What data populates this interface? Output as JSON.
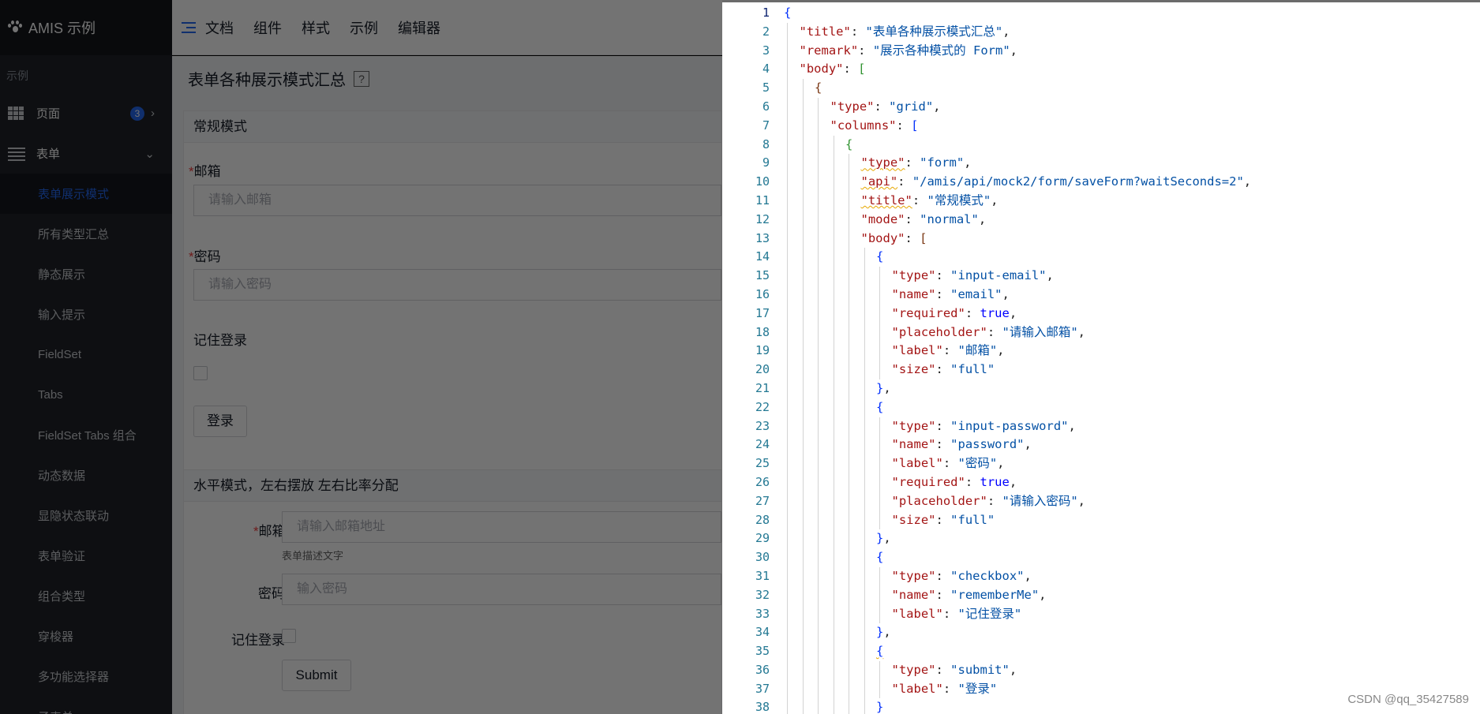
{
  "app": {
    "brand": "AMIS 示例",
    "section_label": "示例",
    "nav": {
      "page": {
        "label": "页面",
        "badge": "3"
      },
      "form": {
        "label": "表单"
      }
    },
    "sub_items": [
      {
        "label": "表单展示模式",
        "active": true
      },
      {
        "label": "所有类型汇总"
      },
      {
        "label": "静态展示"
      },
      {
        "label": "输入提示"
      },
      {
        "label": "FieldSet"
      },
      {
        "label": "Tabs"
      },
      {
        "label": "FieldSet Tabs 组合"
      },
      {
        "label": "动态数据"
      },
      {
        "label": "显隐状态联动"
      },
      {
        "label": "表单验证"
      },
      {
        "label": "组合类型"
      },
      {
        "label": "穿梭器"
      },
      {
        "label": "多功能选择器"
      },
      {
        "label": "子表单"
      }
    ],
    "topbar": [
      "文档",
      "组件",
      "样式",
      "示例",
      "编辑器"
    ],
    "page_title": "表单各种展示模式汇总",
    "help": "?",
    "panel1": {
      "title": "常规模式",
      "email_label": "邮箱",
      "email_placeholder": "请输入邮箱",
      "password_label": "密码",
      "password_placeholder": "请输入密码",
      "remember_label": "记住登录",
      "login_button": "登录"
    },
    "panel2": {
      "title": "水平模式，左右摆放 左右比率分配",
      "email_label": "邮箱",
      "email_placeholder": "请输入邮箱地址",
      "email_desc": "表单描述文字",
      "password_label": "密码",
      "password_placeholder": "输入密码",
      "remember_label": "记住登录",
      "submit_button": "Submit"
    }
  },
  "editor": {
    "line_numbers": [
      "1",
      "2",
      "3",
      "4",
      "5",
      "6",
      "7",
      "8",
      "9",
      "10",
      "11",
      "12",
      "13",
      "14",
      "15",
      "16",
      "17",
      "18",
      "19",
      "20",
      "21",
      "22",
      "23",
      "24",
      "25",
      "26",
      "27",
      "28",
      "29",
      "30",
      "31",
      "32",
      "33",
      "34",
      "35",
      "36",
      "37",
      "38"
    ],
    "lines": [
      {
        "indent": 0,
        "tokens": [
          {
            "t": "{",
            "c": "br1"
          }
        ]
      },
      {
        "indent": 1,
        "tokens": [
          {
            "t": "\"title\"",
            "c": "k"
          },
          {
            "t": ": ",
            "c": "p"
          },
          {
            "t": "\"表单各种展示模式汇总\"",
            "c": "s"
          },
          {
            "t": ",",
            "c": "p"
          }
        ]
      },
      {
        "indent": 1,
        "tokens": [
          {
            "t": "\"remark\"",
            "c": "k"
          },
          {
            "t": ": ",
            "c": "p"
          },
          {
            "t": "\"展示各种模式的 Form\"",
            "c": "s"
          },
          {
            "t": ",",
            "c": "p"
          }
        ]
      },
      {
        "indent": 1,
        "tokens": [
          {
            "t": "\"body\"",
            "c": "k"
          },
          {
            "t": ": ",
            "c": "p"
          },
          {
            "t": "[",
            "c": "br2"
          }
        ]
      },
      {
        "indent": 2,
        "tokens": [
          {
            "t": "{",
            "c": "br3"
          }
        ]
      },
      {
        "indent": 3,
        "tokens": [
          {
            "t": "\"type\"",
            "c": "k"
          },
          {
            "t": ": ",
            "c": "p"
          },
          {
            "t": "\"grid\"",
            "c": "s"
          },
          {
            "t": ",",
            "c": "p"
          }
        ]
      },
      {
        "indent": 3,
        "tokens": [
          {
            "t": "\"columns\"",
            "c": "k"
          },
          {
            "t": ": ",
            "c": "p"
          },
          {
            "t": "[",
            "c": "br1"
          }
        ]
      },
      {
        "indent": 4,
        "tokens": [
          {
            "t": "{",
            "c": "br2"
          }
        ]
      },
      {
        "indent": 5,
        "tokens": [
          {
            "t": "\"type\"",
            "c": "k squig"
          },
          {
            "t": ": ",
            "c": "p"
          },
          {
            "t": "\"form\"",
            "c": "s"
          },
          {
            "t": ",",
            "c": "p"
          }
        ]
      },
      {
        "indent": 5,
        "tokens": [
          {
            "t": "\"api\"",
            "c": "k squig"
          },
          {
            "t": ": ",
            "c": "p"
          },
          {
            "t": "\"/amis/api/mock2/form/saveForm?waitSeconds=2\"",
            "c": "s"
          },
          {
            "t": ",",
            "c": "p"
          }
        ]
      },
      {
        "indent": 5,
        "tokens": [
          {
            "t": "\"title\"",
            "c": "k squig"
          },
          {
            "t": ": ",
            "c": "p"
          },
          {
            "t": "\"常规模式\"",
            "c": "s"
          },
          {
            "t": ",",
            "c": "p"
          }
        ]
      },
      {
        "indent": 5,
        "tokens": [
          {
            "t": "\"mode\"",
            "c": "k"
          },
          {
            "t": ": ",
            "c": "p"
          },
          {
            "t": "\"normal\"",
            "c": "s"
          },
          {
            "t": ",",
            "c": "p"
          }
        ]
      },
      {
        "indent": 5,
        "tokens": [
          {
            "t": "\"body\"",
            "c": "k"
          },
          {
            "t": ": ",
            "c": "p"
          },
          {
            "t": "[",
            "c": "br3"
          }
        ]
      },
      {
        "indent": 6,
        "tokens": [
          {
            "t": "{",
            "c": "br1"
          }
        ]
      },
      {
        "indent": 7,
        "tokens": [
          {
            "t": "\"type\"",
            "c": "k"
          },
          {
            "t": ": ",
            "c": "p"
          },
          {
            "t": "\"input-email\"",
            "c": "s"
          },
          {
            "t": ",",
            "c": "p"
          }
        ]
      },
      {
        "indent": 7,
        "tokens": [
          {
            "t": "\"name\"",
            "c": "k"
          },
          {
            "t": ": ",
            "c": "p"
          },
          {
            "t": "\"email\"",
            "c": "s"
          },
          {
            "t": ",",
            "c": "p"
          }
        ]
      },
      {
        "indent": 7,
        "tokens": [
          {
            "t": "\"required\"",
            "c": "k"
          },
          {
            "t": ": ",
            "c": "p"
          },
          {
            "t": "true",
            "c": "b"
          },
          {
            "t": ",",
            "c": "p"
          }
        ]
      },
      {
        "indent": 7,
        "tokens": [
          {
            "t": "\"placeholder\"",
            "c": "k"
          },
          {
            "t": ": ",
            "c": "p"
          },
          {
            "t": "\"请输入邮箱\"",
            "c": "s"
          },
          {
            "t": ",",
            "c": "p"
          }
        ]
      },
      {
        "indent": 7,
        "tokens": [
          {
            "t": "\"label\"",
            "c": "k"
          },
          {
            "t": ": ",
            "c": "p"
          },
          {
            "t": "\"邮箱\"",
            "c": "s"
          },
          {
            "t": ",",
            "c": "p"
          }
        ]
      },
      {
        "indent": 7,
        "tokens": [
          {
            "t": "\"size\"",
            "c": "k"
          },
          {
            "t": ": ",
            "c": "p"
          },
          {
            "t": "\"full\"",
            "c": "s"
          }
        ]
      },
      {
        "indent": 6,
        "tokens": [
          {
            "t": "}",
            "c": "br1"
          },
          {
            "t": ",",
            "c": "p"
          }
        ]
      },
      {
        "indent": 6,
        "tokens": [
          {
            "t": "{",
            "c": "br1"
          }
        ]
      },
      {
        "indent": 7,
        "tokens": [
          {
            "t": "\"type\"",
            "c": "k"
          },
          {
            "t": ": ",
            "c": "p"
          },
          {
            "t": "\"input-password\"",
            "c": "s"
          },
          {
            "t": ",",
            "c": "p"
          }
        ]
      },
      {
        "indent": 7,
        "tokens": [
          {
            "t": "\"name\"",
            "c": "k"
          },
          {
            "t": ": ",
            "c": "p"
          },
          {
            "t": "\"password\"",
            "c": "s"
          },
          {
            "t": ",",
            "c": "p"
          }
        ]
      },
      {
        "indent": 7,
        "tokens": [
          {
            "t": "\"label\"",
            "c": "k"
          },
          {
            "t": ": ",
            "c": "p"
          },
          {
            "t": "\"密码\"",
            "c": "s"
          },
          {
            "t": ",",
            "c": "p"
          }
        ]
      },
      {
        "indent": 7,
        "tokens": [
          {
            "t": "\"required\"",
            "c": "k"
          },
          {
            "t": ": ",
            "c": "p"
          },
          {
            "t": "true",
            "c": "b"
          },
          {
            "t": ",",
            "c": "p"
          }
        ]
      },
      {
        "indent": 7,
        "tokens": [
          {
            "t": "\"placeholder\"",
            "c": "k"
          },
          {
            "t": ": ",
            "c": "p"
          },
          {
            "t": "\"请输入密码\"",
            "c": "s"
          },
          {
            "t": ",",
            "c": "p"
          }
        ]
      },
      {
        "indent": 7,
        "tokens": [
          {
            "t": "\"size\"",
            "c": "k"
          },
          {
            "t": ": ",
            "c": "p"
          },
          {
            "t": "\"full\"",
            "c": "s"
          }
        ]
      },
      {
        "indent": 6,
        "tokens": [
          {
            "t": "}",
            "c": "br1"
          },
          {
            "t": ",",
            "c": "p"
          }
        ]
      },
      {
        "indent": 6,
        "tokens": [
          {
            "t": "{",
            "c": "br1"
          }
        ]
      },
      {
        "indent": 7,
        "tokens": [
          {
            "t": "\"type\"",
            "c": "k"
          },
          {
            "t": ": ",
            "c": "p"
          },
          {
            "t": "\"checkbox\"",
            "c": "s"
          },
          {
            "t": ",",
            "c": "p"
          }
        ]
      },
      {
        "indent": 7,
        "tokens": [
          {
            "t": "\"name\"",
            "c": "k"
          },
          {
            "t": ": ",
            "c": "p"
          },
          {
            "t": "\"rememberMe\"",
            "c": "s"
          },
          {
            "t": ",",
            "c": "p"
          }
        ]
      },
      {
        "indent": 7,
        "tokens": [
          {
            "t": "\"label\"",
            "c": "k"
          },
          {
            "t": ": ",
            "c": "p"
          },
          {
            "t": "\"记住登录\"",
            "c": "s"
          }
        ]
      },
      {
        "indent": 6,
        "tokens": [
          {
            "t": "}",
            "c": "br1"
          },
          {
            "t": ",",
            "c": "p"
          }
        ]
      },
      {
        "indent": 6,
        "tokens": [
          {
            "t": "{",
            "c": "br1 squig"
          }
        ]
      },
      {
        "indent": 7,
        "tokens": [
          {
            "t": "\"type\"",
            "c": "k"
          },
          {
            "t": ": ",
            "c": "p"
          },
          {
            "t": "\"submit\"",
            "c": "s"
          },
          {
            "t": ",",
            "c": "p"
          }
        ]
      },
      {
        "indent": 7,
        "tokens": [
          {
            "t": "\"label\"",
            "c": "k"
          },
          {
            "t": ": ",
            "c": "p"
          },
          {
            "t": "\"登录\"",
            "c": "s"
          }
        ]
      },
      {
        "indent": 6,
        "tokens": [
          {
            "t": "}",
            "c": "br1"
          }
        ]
      }
    ],
    "watermark": "CSDN @qq_35427589"
  }
}
